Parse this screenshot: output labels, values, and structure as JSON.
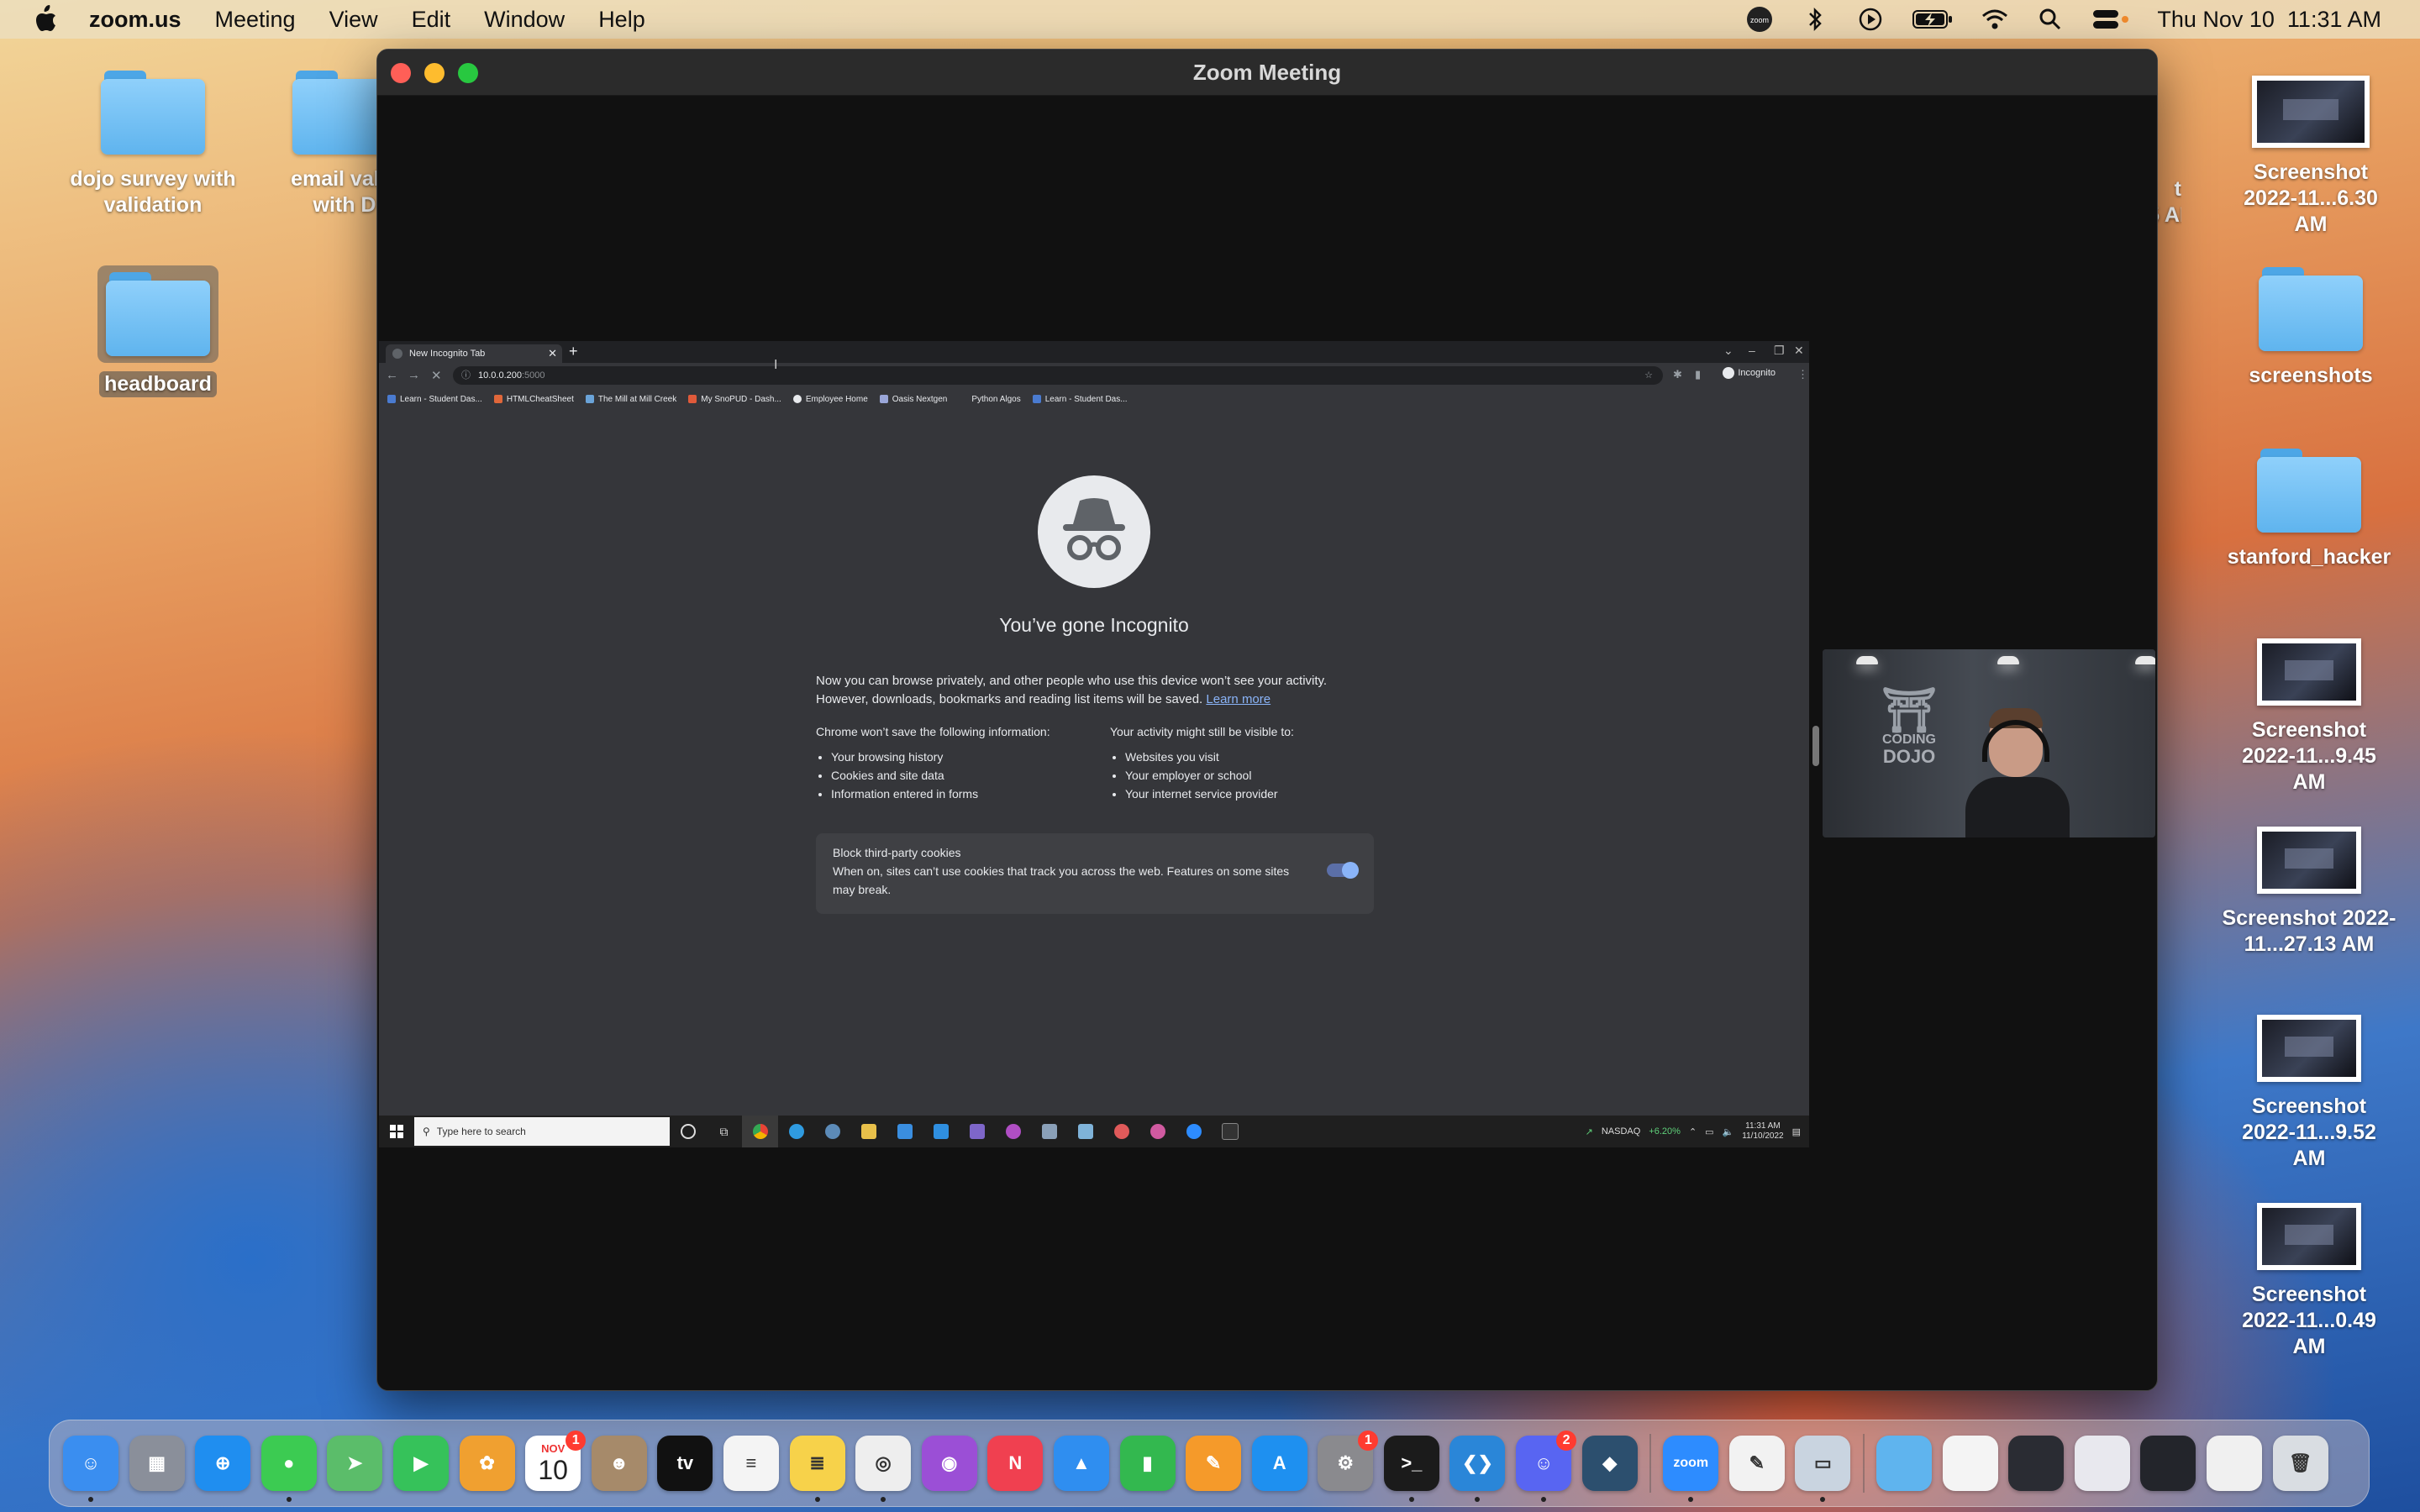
{
  "menubar": {
    "app_name": "zoom.us",
    "items": [
      "Meeting",
      "View",
      "Edit",
      "Window",
      "Help"
    ],
    "clock": "Thu Nov 10  11:31 AM",
    "status_icons": [
      "zoom-status-icon",
      "bluetooth-icon",
      "play-icon",
      "battery-icon",
      "wifi-icon",
      "spotlight-search-icon",
      "control-center-icon"
    ]
  },
  "desktop": {
    "left_icons": [
      {
        "label": "dojo survey with validation",
        "kind": "folder"
      },
      {
        "label": "email valid with D",
        "kind": "folder"
      },
      {
        "label": "headboard",
        "kind": "folder"
      }
    ],
    "partial_label": "t\n5 AM",
    "right_icons": [
      {
        "label": "Screenshot 2022-11...6.30 AM",
        "kind": "screenshot"
      },
      {
        "label": "screenshots",
        "kind": "folder"
      },
      {
        "label": "stanford_hacker",
        "kind": "folder"
      },
      {
        "label": "Screenshot 2022-11...9.45 AM",
        "kind": "screenshot"
      },
      {
        "label": "Screenshot 2022-11...27.13 AM",
        "kind": "screenshot"
      },
      {
        "label": "Screenshot 2022-11...9.52 AM",
        "kind": "screenshot"
      },
      {
        "label": "Screenshot 2022-11...0.49 AM",
        "kind": "screenshot"
      }
    ]
  },
  "zoom": {
    "title": "Zoom Meeting"
  },
  "chrome": {
    "tab_title": "New Incognito Tab",
    "url": "10.0.0.200",
    "url_port": ":5000",
    "incognito_chip": "Incognito",
    "bookmarks": [
      {
        "label": "Learn - Student Das...",
        "color": "#4a7bd0"
      },
      {
        "label": "HTMLCheatSheet",
        "color": "#e0673a"
      },
      {
        "label": "The Mill at Mill Creek",
        "color": "#6aa3d8"
      },
      {
        "label": "My SnoPUD - Dash...",
        "color": "#e05a3a"
      },
      {
        "label": "Employee Home",
        "color": "#e8eaed"
      },
      {
        "label": "Oasis Nextgen",
        "color": "#9aa6d8"
      },
      {
        "label": "Python Algos",
        "color": "#35363a"
      },
      {
        "label": "Learn - Student Das...",
        "color": "#4a7bd0"
      }
    ],
    "page": {
      "headline": "You’ve gone Incognito",
      "intro_1": "Now you can browse privately, and other people who use this device won’t see your activity.",
      "intro_2": "However, downloads, bookmarks and reading list items will be saved.",
      "learn_more": "Learn more",
      "left_heading": "Chrome won’t save the following information:",
      "left_items": [
        "Your browsing history",
        "Cookies and site data",
        "Information entered in forms"
      ],
      "right_heading": "Your activity might still be visible to:",
      "right_items": [
        "Websites you visit",
        "Your employer or school",
        "Your internet service provider"
      ],
      "cookie_title": "Block third-party cookies",
      "cookie_text": "When on, sites can’t use cookies that track you across the web. Features on some sites may break.",
      "cookie_toggle_on": true
    }
  },
  "windows_taskbar": {
    "search_placeholder": "Type here to search",
    "apps": [
      {
        "name": "cortana-icon",
        "color": "#dddddd"
      },
      {
        "name": "task-view-icon",
        "color": "#dddddd"
      },
      {
        "name": "chrome-icon",
        "color": "#e8b23a"
      },
      {
        "name": "edge-icon",
        "color": "#2f9be0"
      },
      {
        "name": "steam-icon",
        "color": "#5c8bb8"
      },
      {
        "name": "file-explorer-icon",
        "color": "#e8c04a"
      },
      {
        "name": "mail-icon",
        "color": "#3a8ee0"
      },
      {
        "name": "vscode-icon",
        "color": "#2f8fe0"
      },
      {
        "name": "visual-studio-icon",
        "color": "#7e66c9"
      },
      {
        "name": "app-icon",
        "color": "#b04ec4"
      },
      {
        "name": "calculator-icon",
        "color": "#8aa0b8"
      },
      {
        "name": "notepad-icon",
        "color": "#7fb3d9"
      },
      {
        "name": "chrome-profile-icon",
        "color": "#e05a5a"
      },
      {
        "name": "chrome-profile-2-icon",
        "color": "#d05aa0"
      },
      {
        "name": "zoom-icon",
        "color": "#2d8cff"
      },
      {
        "name": "terminal-icon",
        "color": "#333333"
      }
    ],
    "stock_label": "NASDAQ",
    "stock_change": "+6.20%",
    "time": "11:31 AM",
    "date": "11/10/2022"
  },
  "dock": {
    "calendar_month": "NOV",
    "calendar_day": "10",
    "apps": [
      {
        "name": "finder-icon",
        "color": "#3a8ef0",
        "glyph": "☺",
        "running": true
      },
      {
        "name": "launchpad-icon",
        "color": "#8a8f9a",
        "glyph": "▦",
        "running": false
      },
      {
        "name": "safari-icon",
        "color": "#1f8ef0",
        "glyph": "⊕",
        "running": false
      },
      {
        "name": "messages-icon",
        "color": "#3ccb52",
        "glyph": "●",
        "running": true
      },
      {
        "name": "maps-icon",
        "color": "#5bbd6a",
        "glyph": "➤",
        "running": false
      },
      {
        "name": "facetime-icon",
        "color": "#36c25a",
        "glyph": "▶",
        "running": false
      },
      {
        "name": "photos-icon",
        "color": "#f0a030",
        "glyph": "✿",
        "running": false
      },
      {
        "name": "calendar-icon",
        "color": "#ffffff",
        "glyph": "",
        "running": false,
        "badge": "1"
      },
      {
        "name": "contacts-icon",
        "color": "#a68a6a",
        "glyph": "☻",
        "running": false
      },
      {
        "name": "apple-tv-icon",
        "color": "#111111",
        "glyph": "tv",
        "running": false
      },
      {
        "name": "reminders-icon",
        "color": "#f4f4f4",
        "glyph": "≡",
        "running": false
      },
      {
        "name": "notes-icon",
        "color": "#f7d24a",
        "glyph": "≣",
        "running": true
      },
      {
        "name": "chrome-icon",
        "color": "#eeeeee",
        "glyph": "◎",
        "running": true
      },
      {
        "name": "podcasts-icon",
        "color": "#9b4fd6",
        "glyph": "◉",
        "running": false
      },
      {
        "name": "news-icon",
        "color": "#f04050",
        "glyph": "N",
        "running": false
      },
      {
        "name": "keynote-icon",
        "color": "#2f8ef0",
        "glyph": "▲",
        "running": false
      },
      {
        "name": "numbers-icon",
        "color": "#33b84f",
        "glyph": "▮",
        "running": false
      },
      {
        "name": "pages-icon",
        "color": "#f59a2a",
        "glyph": "✎",
        "running": false
      },
      {
        "name": "app-store-icon",
        "color": "#1e90f0",
        "glyph": "A",
        "running": false
      },
      {
        "name": "system-preferences-icon",
        "color": "#8a8a8e",
        "glyph": "⚙",
        "running": false,
        "badge": "1"
      },
      {
        "name": "terminal-icon",
        "color": "#1b1b1b",
        "glyph": ">_",
        "running": true
      },
      {
        "name": "vscode-icon",
        "color": "#2a86d8",
        "glyph": "❮❯",
        "running": true
      },
      {
        "name": "discord-icon",
        "color": "#5865f2",
        "glyph": "☺",
        "running": true,
        "badge": "2"
      },
      {
        "name": "mysql-workbench-icon",
        "color": "#2c4f6e",
        "glyph": "◆",
        "running": false
      },
      {
        "name": "SEP",
        "color": "",
        "glyph": "",
        "running": false
      },
      {
        "name": "zoom-icon",
        "color": "#2d8cff",
        "glyph": "zoom",
        "running": true
      },
      {
        "name": "textedit-icon",
        "color": "#f2f2f2",
        "glyph": "✎",
        "running": false
      },
      {
        "name": "preview-icon",
        "color": "#c9d4e0",
        "glyph": "▭",
        "running": true
      },
      {
        "name": "SEP",
        "color": "",
        "glyph": "",
        "running": false
      },
      {
        "name": "downloads-folder-icon",
        "color": "#5fb4ee",
        "glyph": "",
        "running": false
      },
      {
        "name": "recent-doc-icon",
        "color": "#f4f4f4",
        "glyph": "",
        "running": false
      },
      {
        "name": "recent-doc-icon",
        "color": "#2a2c33",
        "glyph": "",
        "running": false
      },
      {
        "name": "recent-doc-icon",
        "color": "#e8e8ee",
        "glyph": "",
        "running": false
      },
      {
        "name": "recent-doc-icon",
        "color": "#23252b",
        "glyph": "",
        "running": false
      },
      {
        "name": "recent-doc-icon",
        "color": "#f0f0f0",
        "glyph": "",
        "running": false
      },
      {
        "name": "trash-icon",
        "color": "#d9dde2",
        "glyph": "🗑",
        "running": false
      }
    ]
  }
}
